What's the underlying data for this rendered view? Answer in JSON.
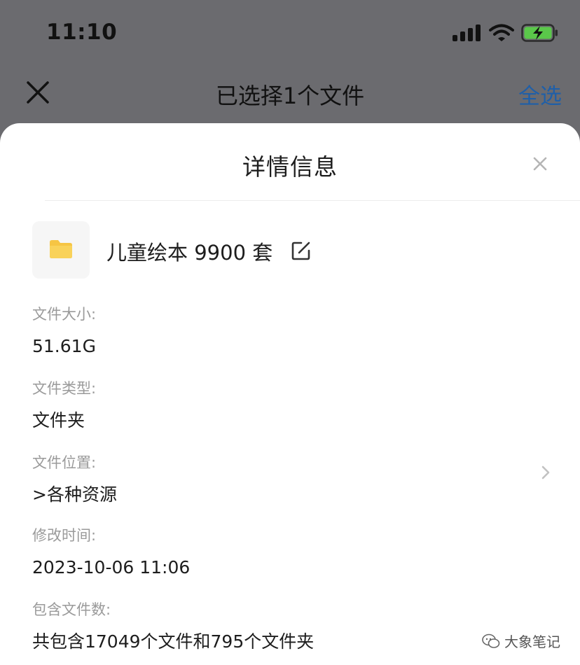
{
  "status_bar": {
    "time": "11:10"
  },
  "nav": {
    "title": "已选择1个文件",
    "select_all": "全选"
  },
  "sheet": {
    "title": "详情信息",
    "file": {
      "name": "儿童绘本 9900 套"
    },
    "fields": [
      {
        "label": "文件大小:",
        "value": "51.61G"
      },
      {
        "label": "文件类型:",
        "value": "文件夹"
      },
      {
        "label": "文件位置:",
        "value": ">各种资源"
      },
      {
        "label": "修改时间:",
        "value": "2023-10-06 11:06"
      },
      {
        "label": "包含文件数:",
        "value": "共包含17049个文件和795个文件夹"
      }
    ]
  },
  "watermark": {
    "text": "大象笔记"
  },
  "colors": {
    "accent": "#1f5fa8",
    "folder": "#f6c544",
    "battery": "#5ac84a",
    "overlay": "#6b6b6f"
  },
  "icons": [
    "signal-icon",
    "wifi-icon",
    "battery-charging-icon",
    "close-x-icon",
    "folder-icon",
    "edit-icon",
    "chevron-right-icon",
    "wechat-icon"
  ]
}
